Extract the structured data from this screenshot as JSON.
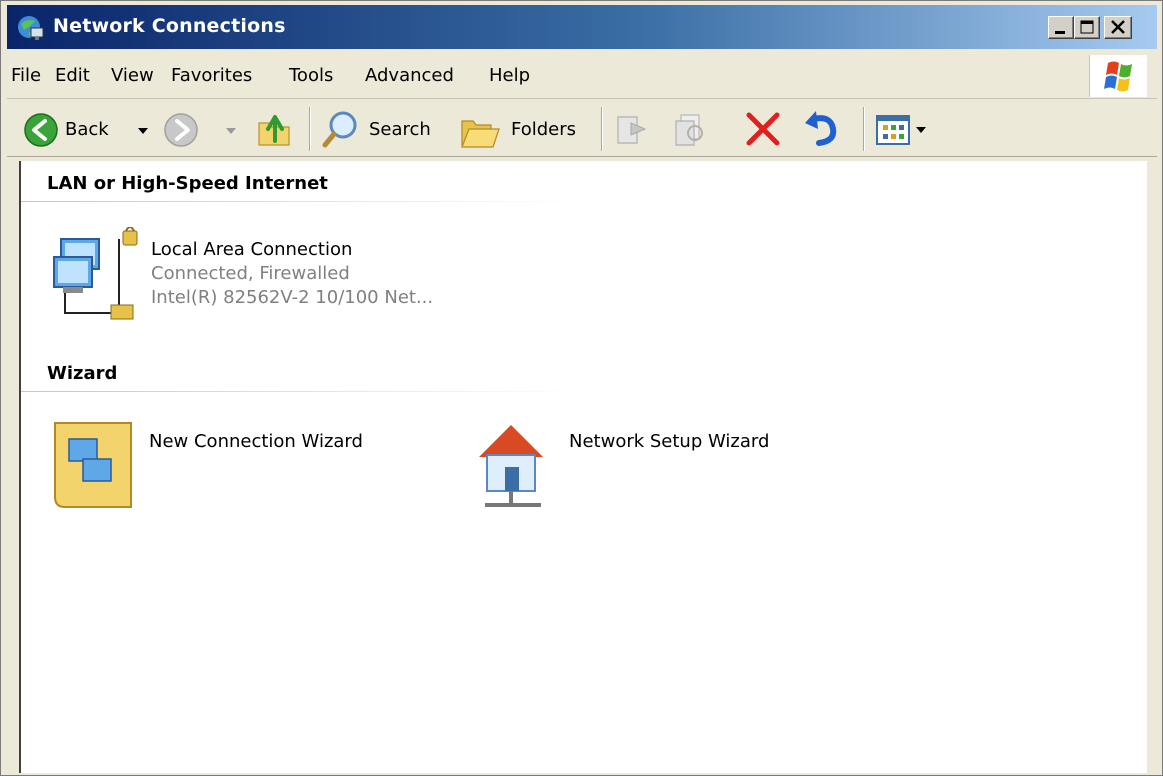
{
  "window": {
    "title": "Network Connections"
  },
  "menu": {
    "file": "File",
    "edit": "Edit",
    "view": "View",
    "favorites": "Favorites",
    "tools": "Tools",
    "advanced": "Advanced",
    "help": "Help"
  },
  "toolbar": {
    "back_label": "Back",
    "search_label": "Search",
    "folders_label": "Folders"
  },
  "groups": [
    {
      "header": "LAN or High-Speed Internet",
      "items": [
        {
          "name": "Local Area Connection",
          "status": "Connected, Firewalled",
          "device": "Intel(R) 82562V-2 10/100 Net..."
        }
      ]
    },
    {
      "header": "Wizard",
      "items": [
        {
          "name": "New Connection Wizard"
        },
        {
          "name": "Network Setup Wizard"
        }
      ]
    }
  ],
  "icons": {
    "title": "network-connections-icon",
    "back": "back-arrow-icon",
    "forward": "forward-arrow-icon",
    "up": "up-folder-icon",
    "search": "search-magnifier-icon",
    "folders": "folders-icon",
    "move_to": "move-to-icon",
    "copy_to": "copy-to-icon",
    "delete": "delete-x-icon",
    "undo": "undo-icon",
    "views": "views-icon",
    "xp_logo": "windows-flag-icon"
  },
  "colors": {
    "titlebar_start": "#0a246a",
    "titlebar_end": "#a6caf0",
    "chrome": "#ece9d8",
    "delete_red": "#e02020",
    "undo_blue": "#1f5fd0",
    "go_green": "#3aa33a"
  }
}
